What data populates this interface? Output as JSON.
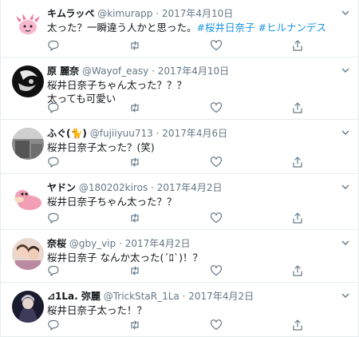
{
  "tweets": [
    {
      "name": "キムラッペ",
      "handle": "@kimurapp",
      "date": "2017年4月10日",
      "text_plain": "太った？一瞬違う人かと思った。",
      "hashtag1": "#桜井日奈子",
      "hashtag2": "#ヒルナンデス",
      "avatar_icon": "pink-monster-icon"
    },
    {
      "name": "原 麗奈",
      "handle": "@Wayof_easy",
      "date": "2017年4月10日",
      "line1": "桜井日奈子ちゃん太った？？？",
      "line2": "太っても可愛い",
      "avatar_icon": "dark-face-icon"
    },
    {
      "name": "ふぐ(🐈)",
      "handle": "@fujiiyuu713",
      "date": "2017年4月6日",
      "line1": "桜井日奈子太った？(笑)",
      "avatar_icon": "gray-photo-icon"
    },
    {
      "name": "ヤドン",
      "handle": "@180202kiros",
      "date": "2017年4月2日",
      "line1": "桜井日奈子ちゃん太った？？",
      "avatar_icon": "slowpoke-icon"
    },
    {
      "name": "奈桜",
      "handle": "@gby_vip",
      "date": "2017年4月2日",
      "line1": "桜井日奈子 なんか太った(´ﾛ`)！？",
      "avatar_icon": "girls-photo-icon"
    },
    {
      "name": "⊿1La. 弥麗",
      "handle": "@TrickStaR_1La",
      "date": "2017年4月2日",
      "line1": "桜井日奈子太った！？",
      "avatar_icon": "anime-character-icon"
    }
  ],
  "separator": "·",
  "colors": {
    "text": "#14171a",
    "muted": "#657786",
    "link": "#1b95e0",
    "border": "#e6ecf0"
  }
}
